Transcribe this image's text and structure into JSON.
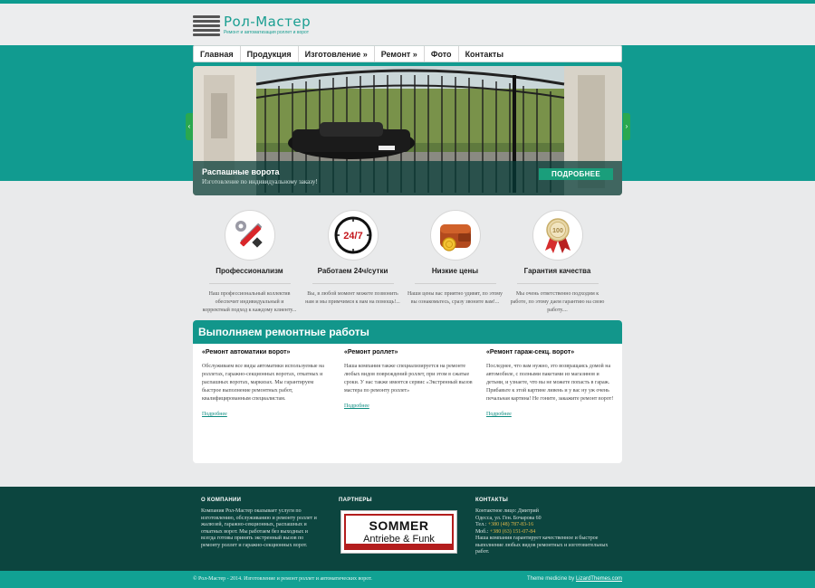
{
  "brand": {
    "title": "Рол-Мастер",
    "tagline": "Ремонт и автоматизация роллет и ворот"
  },
  "nav": {
    "items": [
      "Главная",
      "Продукция",
      "Изготовление »",
      "Ремонт »",
      "Фото",
      "Контакты"
    ]
  },
  "slider": {
    "title": "Распашные ворота",
    "text": "Изготовление по индивидуальному заказу!",
    "button": "ПОДРОБНЕЕ",
    "prev_icon": "chevron-left",
    "next_icon": "chevron-right"
  },
  "features": [
    {
      "icon": "tools-icon",
      "title": "Профессионализм",
      "text": "Наш профессиональный коллектив обеспечит индивидуальный и корректный подход к каждому клиенту..."
    },
    {
      "icon": "clock-24-7-icon",
      "badge": "24/7",
      "title": "Работаем 24ч/сутки",
      "text": "Вы, в любой момент можете позвонить нам и мы примчимся к вам на помощь!..."
    },
    {
      "icon": "wallet-icon",
      "title": "Низкие цены",
      "text": "Наши цены вас приятно удивят, по этому вы ознакомьтесь, сразу звоните вам!..."
    },
    {
      "icon": "medal-icon",
      "badge": "100",
      "title": "Гарантия качества",
      "text": "Мы очень ответственно подходим к работе, по этому даем гарантию на свою работу...."
    }
  ],
  "repair": {
    "heading": "Выполняем ремонтные работы",
    "columns": [
      {
        "title": "«Ремонт автоматики ворот»",
        "text": "Обслуживаем все виды автоматики используемые на роллетах, гаражно-секционных воротах, откатных и распашных воротах, маркизах. Мы гарантируем быстрое выполнение ремонтных работ, квалифицированным специалистам.",
        "link": "Подробнее"
      },
      {
        "title": "«Ремонт роллет»",
        "text": "Наша компания также специализируется на ремонте любых видов повреждений роллет, при этом в сжатые сроки. У нас также имеется сервис «Экстренный вызов мастера по ремонту роллет»",
        "link": "Подробнее"
      },
      {
        "title": "«Ремонт гараж-секц. ворот»",
        "text": "Последнее, что вам нужно, это возвращаясь домой на автомобиле, с полными пакетами из магазинов и детьми, и узнаете, что вы не можете попасть в гараж. Прибавьте к этой картине ливень и у вас ну уж очень печальная картина! Не гоните, закажите ремонт ворот!",
        "link": "Подробнее"
      }
    ]
  },
  "footer": {
    "about": {
      "title": "О КОМПАНИИ",
      "text": "Компания Рол-Мастер оказывает услуги по изготовлению, обслуживанию и ремонту роллет и жалюзей, гаражно-секционных, распашных и откатных ворот. Мы работаем без выходных и всегда готовы принять экстренный вызов по ремонту роллет и гаражно-секционных ворот."
    },
    "partners": {
      "title": "ПАРТНЕРЫ",
      "logo_brand": "SOMMER",
      "logo_tag": "Antriebe & Funk"
    },
    "contacts": {
      "title": "КОНТАКТЫ",
      "person": "Контактное лицо: Дмитрий",
      "address": "Одесса, ул. Ген. Бочарова 60",
      "phone_label": "Тел.:",
      "phone": "+380 (48) 787-83-16",
      "mobile_label": "Моб.:",
      "mobile": "+380 (63) 151-07-84",
      "text": "Наша компания гарантирует качественное и быстрое выполнение любых видов ремонтных и изготовительных работ."
    }
  },
  "copyright": {
    "text": "© Рол-Мастер - 2014. Изготовление и ремонт роллет и автоматических ворот.",
    "theme_prefix": "Theme medicine by",
    "theme_link": "LizardThemes.com"
  },
  "colors": {
    "teal": "#119b90",
    "dark_teal": "#0c453f",
    "button_green": "#1a9e7b"
  }
}
